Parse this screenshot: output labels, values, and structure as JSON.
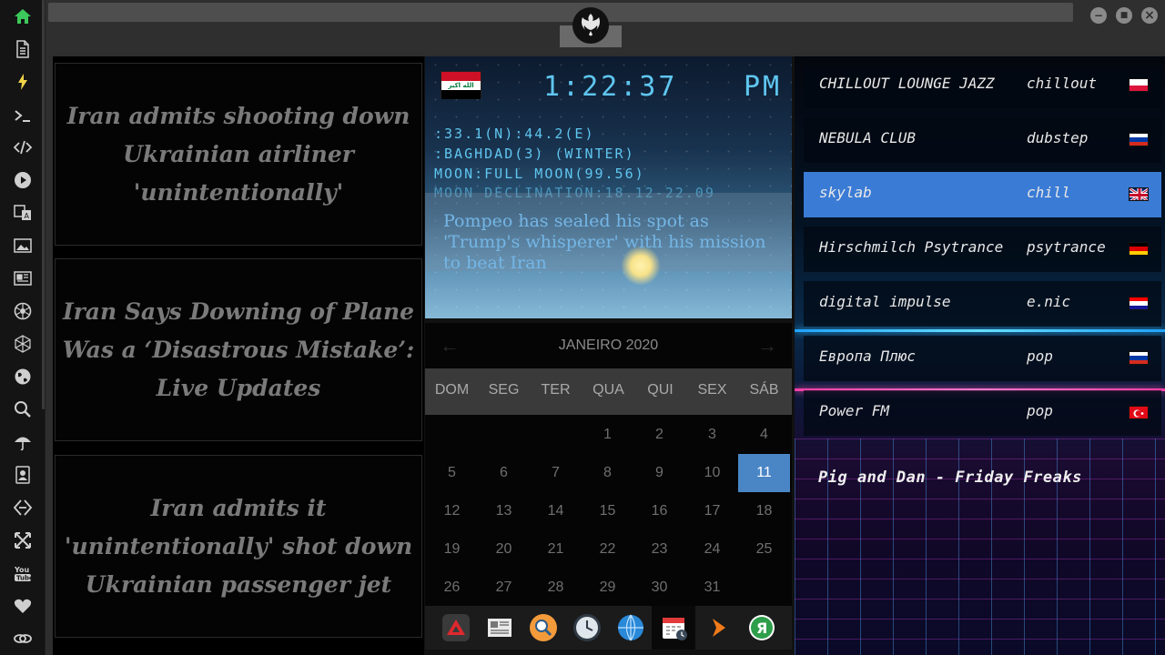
{
  "sidebar": {
    "icons": [
      "home-icon",
      "document-icon",
      "bolt-icon",
      "terminal-icon",
      "code-icon",
      "play-icon",
      "translate-icon",
      "image-icon",
      "newspaper-icon",
      "aperture-icon",
      "hexagon-icon",
      "globe-icon",
      "search-icon",
      "umbrella-icon",
      "contacts-icon",
      "transfer-icon",
      "expand-icon",
      "youtube-icon",
      "heart-icon",
      "link-icon"
    ],
    "accent_color": "#3cc85a",
    "highlight_color": "#f3d54a"
  },
  "window": {
    "minimize": "−",
    "maximize": "■",
    "close": "×"
  },
  "news": [
    {
      "title": "Iran admits shooting down Ukrainian airliner 'unintentionally'"
    },
    {
      "title": "Iran Says Downing of Plane Was a ‘Disastrous Mistake’: Live Updates"
    },
    {
      "title": "Iran admits it 'unintentionally' shot down Ukrainian passenger jet"
    }
  ],
  "clock": {
    "time": "1:22:37",
    "ampm": "PM",
    "coords": ":33.1(N):44.2(E)",
    "location": ":BAGHDAD(3) (WINTER)",
    "moon": "MOON:FULL MOON(99.56)",
    "moon_declination": "MOON DECLINATION:18.12-22.09",
    "headline": "Pompeo has sealed his spot as 'Trump's whisperer' with his mission to beat Iran",
    "flag_text": "الله اكبر"
  },
  "calendar": {
    "month_label": "JANEIRO 2020",
    "prev": "←",
    "next": "→",
    "weekdays": [
      "DOM",
      "SEG",
      "TER",
      "QUA",
      "QUI",
      "SEX",
      "SÁB"
    ],
    "days": [
      "1",
      "2",
      "3",
      "4",
      "5",
      "6",
      "7",
      "8",
      "9",
      "10",
      "11",
      "12",
      "13",
      "14",
      "15",
      "16",
      "17",
      "18",
      "19",
      "20",
      "21",
      "22",
      "23",
      "24",
      "25",
      "26",
      "27",
      "28",
      "29",
      "30",
      "31"
    ],
    "today": "11"
  },
  "dock": {
    "apps": [
      "triangle-app-icon",
      "news-app-icon",
      "search-app-icon",
      "clock-app-icon",
      "globe-app-icon",
      "calendar-app-icon",
      "play-app-icon",
      "yandex-app-icon"
    ]
  },
  "radio": {
    "stations": [
      {
        "name": "CHILLOUT LOUNGE JAZZ",
        "genre": "chillout",
        "flag": "poland",
        "flag_colors": [
          "#ffffff",
          "#ffffff",
          "#dc143c"
        ]
      },
      {
        "name": "NEBULA CLUB",
        "genre": "dubstep",
        "flag": "russia",
        "flag_colors": [
          "#ffffff",
          "#0039a6",
          "#d52b1e"
        ]
      },
      {
        "name": "skylab",
        "genre": "chill",
        "flag": "united-kingdom",
        "flag_colors": [
          "#012169",
          "#c8102e",
          "#012169"
        ]
      },
      {
        "name": "Hirschmilch Psytrance",
        "genre": "psytrance",
        "flag": "germany",
        "flag_colors": [
          "#000000",
          "#dd0000",
          "#ffce00"
        ]
      },
      {
        "name": "digital impulse",
        "genre": "e.nic",
        "flag": "croatia",
        "flag_colors": [
          "#ff0000",
          "#ffffff",
          "#171796"
        ]
      },
      {
        "name": "Европа Плюс",
        "genre": "pop",
        "flag": "russia",
        "flag_colors": [
          "#ffffff",
          "#0039a6",
          "#d52b1e"
        ]
      },
      {
        "name": "Power FM",
        "genre": "pop",
        "flag": "turkey",
        "flag_colors": [
          "#e30a17",
          "#e30a17",
          "#e30a17"
        ]
      }
    ],
    "selected_index": 2,
    "now_playing": "Pig and Dan - Friday Freaks"
  }
}
